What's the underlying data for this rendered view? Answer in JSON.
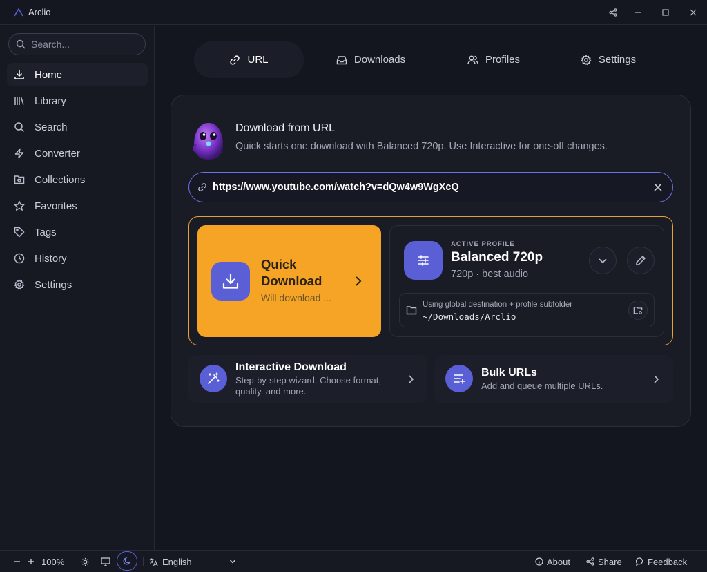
{
  "app": {
    "title": "Arclio"
  },
  "sidebar": {
    "search_placeholder": "Search...",
    "items": [
      {
        "label": "Home",
        "icon": "download-icon",
        "active": true
      },
      {
        "label": "Library",
        "icon": "library-icon"
      },
      {
        "label": "Search",
        "icon": "search-icon"
      },
      {
        "label": "Converter",
        "icon": "lightning-icon"
      },
      {
        "label": "Collections",
        "icon": "folder-heart-icon"
      },
      {
        "label": "Favorites",
        "icon": "star-icon"
      },
      {
        "label": "Tags",
        "icon": "tag-icon"
      },
      {
        "label": "History",
        "icon": "clock-icon"
      },
      {
        "label": "Settings",
        "icon": "gear-icon"
      }
    ]
  },
  "tabs": [
    {
      "label": "URL",
      "icon": "link-icon",
      "active": true
    },
    {
      "label": "Downloads",
      "icon": "inbox-icon"
    },
    {
      "label": "Profiles",
      "icon": "users-icon"
    },
    {
      "label": "Settings",
      "icon": "gear-icon"
    }
  ],
  "main": {
    "title": "Download from URL",
    "subtitle": "Quick starts one download with Balanced 720p. Use Interactive for one-off changes.",
    "url_value": "https://www.youtube.com/watch?v=dQw4w9WgXcQ",
    "quick": {
      "title": "Quick Download",
      "subtitle": "Will download ..."
    },
    "profile": {
      "label": "ACTIVE PROFILE",
      "name": "Balanced 720p",
      "desc": "720p · best audio",
      "dest_label": "Using global destination + profile subfolder",
      "dest_path": "~/Downloads/Arclio"
    },
    "interactive": {
      "title": "Interactive Download",
      "subtitle": "Step-by-step wizard. Choose format, quality, and more."
    },
    "bulk": {
      "title": "Bulk URLs",
      "subtitle": "Add and queue multiple URLs."
    }
  },
  "bottombar": {
    "zoom": "100%",
    "language": "English",
    "about": "About",
    "share": "Share",
    "feedback": "Feedback"
  },
  "colors": {
    "accent": "#5b5fd6",
    "quick": "#f5a425",
    "background": "#14161f"
  }
}
